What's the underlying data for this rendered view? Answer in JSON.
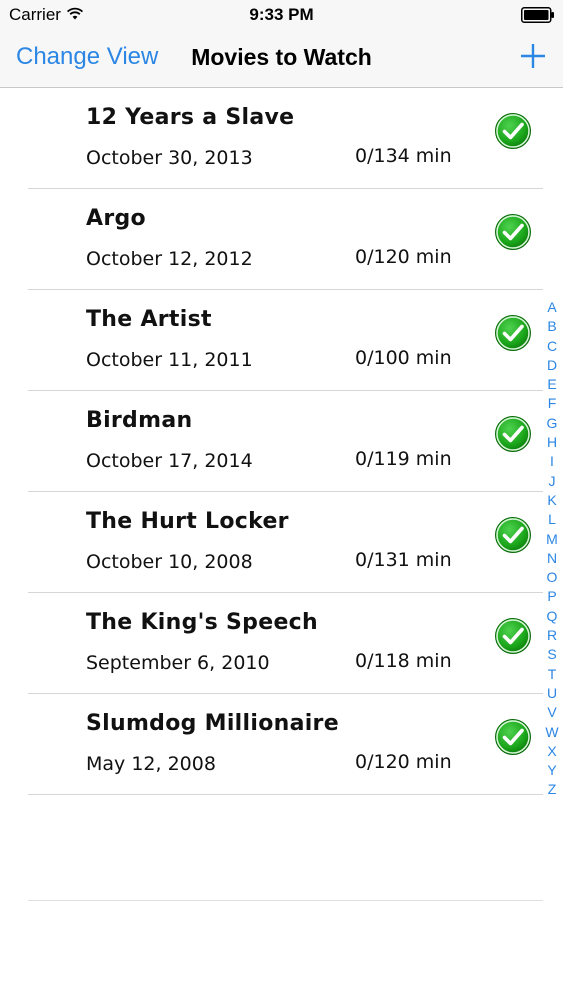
{
  "status_bar": {
    "carrier": "Carrier",
    "time": "9:33 PM"
  },
  "nav": {
    "left_button": "Change View",
    "title": "Movies to Watch",
    "add_icon": "plus-icon",
    "accent_color": "#2b86e4"
  },
  "movies": [
    {
      "title": "12 Years a Slave",
      "date": "October 30, 2013",
      "runtime": "0/134 min",
      "watched": true
    },
    {
      "title": "Argo",
      "date": "October 12, 2012",
      "runtime": "0/120 min",
      "watched": true
    },
    {
      "title": "The Artist",
      "date": "October 11, 2011",
      "runtime": "0/100 min",
      "watched": true
    },
    {
      "title": "Birdman",
      "date": "October 17, 2014",
      "runtime": "0/119 min",
      "watched": true
    },
    {
      "title": "The Hurt Locker",
      "date": "October 10, 2008",
      "runtime": "0/131 min",
      "watched": true
    },
    {
      "title": "The King's Speech",
      "date": "September 6, 2010",
      "runtime": "0/118 min",
      "watched": true
    },
    {
      "title": "Slumdog Millionaire",
      "date": "May 12, 2008",
      "runtime": "0/120 min",
      "watched": true
    }
  ],
  "check_color": "#1aa51a",
  "index_letters": [
    "A",
    "B",
    "C",
    "D",
    "E",
    "F",
    "G",
    "H",
    "I",
    "J",
    "K",
    "L",
    "M",
    "N",
    "O",
    "P",
    "Q",
    "R",
    "S",
    "T",
    "U",
    "V",
    "W",
    "X",
    "Y",
    "Z"
  ]
}
